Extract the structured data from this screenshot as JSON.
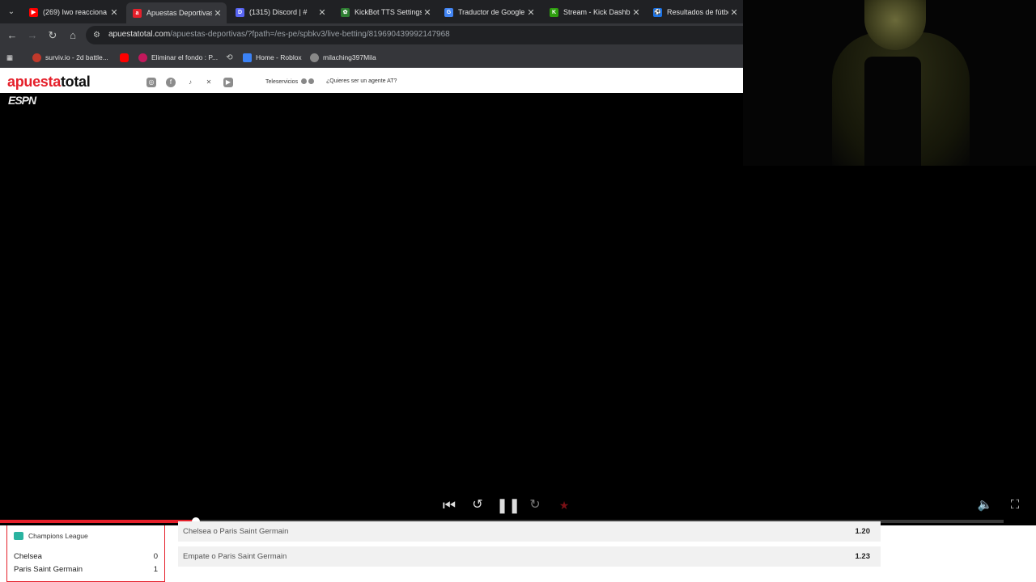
{
  "browser": {
    "tabs": [
      {
        "title": "(269) Iwo reacciona a",
        "fav_color": "#ff0000",
        "fav_glyph": "▶"
      },
      {
        "title": "Apuestas Deportivas",
        "fav_color": "#e5202b",
        "fav_glyph": "a"
      },
      {
        "title": "(1315) Discord | #",
        "fav_color": "#5865f2",
        "fav_glyph": "D"
      },
      {
        "title": "KickBot TTS Settings",
        "fav_color": "#53fc18",
        "fav_glyph": "✿"
      },
      {
        "title": "Traductor de Google",
        "fav_color": "#4285f4",
        "fav_glyph": "G"
      },
      {
        "title": "Stream - Kick Dashb",
        "fav_color": "#53fc18",
        "fav_glyph": "K"
      },
      {
        "title": "Resultados de fútbol",
        "fav_color": "#1a73e8",
        "fav_glyph": "⚽"
      }
    ],
    "url_host": "apuestatotal.com",
    "url_path": "/apuestas-deportivas/?fpath=/es-pe/spbkv3/live-betting/819690439992147968",
    "bookmarks": [
      {
        "label": "surviv.io - 2d battle...",
        "icon_color": "#c0392b"
      },
      {
        "label": "",
        "icon_color": "#ff0000"
      },
      {
        "label": "Eliminar el fondo : P...",
        "icon_color": "#c2185b"
      },
      {
        "label": "",
        "icon_color": "#888888"
      },
      {
        "label": "Home - Roblox",
        "icon_color": "#3b82f6"
      },
      {
        "label": "milaching397Mila",
        "icon_color": "#888888"
      }
    ]
  },
  "site": {
    "logo_part1": "apuesta",
    "logo_part2": "total",
    "teleservicios": "Teleservicios",
    "agent": "¿Quieres ser un agente AT?"
  },
  "video": {
    "broadcaster": "ESPN",
    "progress_fraction": 0.195
  },
  "bet": {
    "league": "Champions League",
    "team1": "Chelsea",
    "team1_score": "0",
    "team2": "Paris Saint Germain",
    "team2_score": "1",
    "odds": [
      {
        "label": "Chelsea o Paris Saint Germain",
        "value": "1.20"
      },
      {
        "label": "Empate o Paris Saint Germain",
        "value": "1.23"
      }
    ]
  },
  "colors": {
    "brand": "#e5202b",
    "chrome_dark": "#202124",
    "chrome_mid": "#35363a"
  }
}
